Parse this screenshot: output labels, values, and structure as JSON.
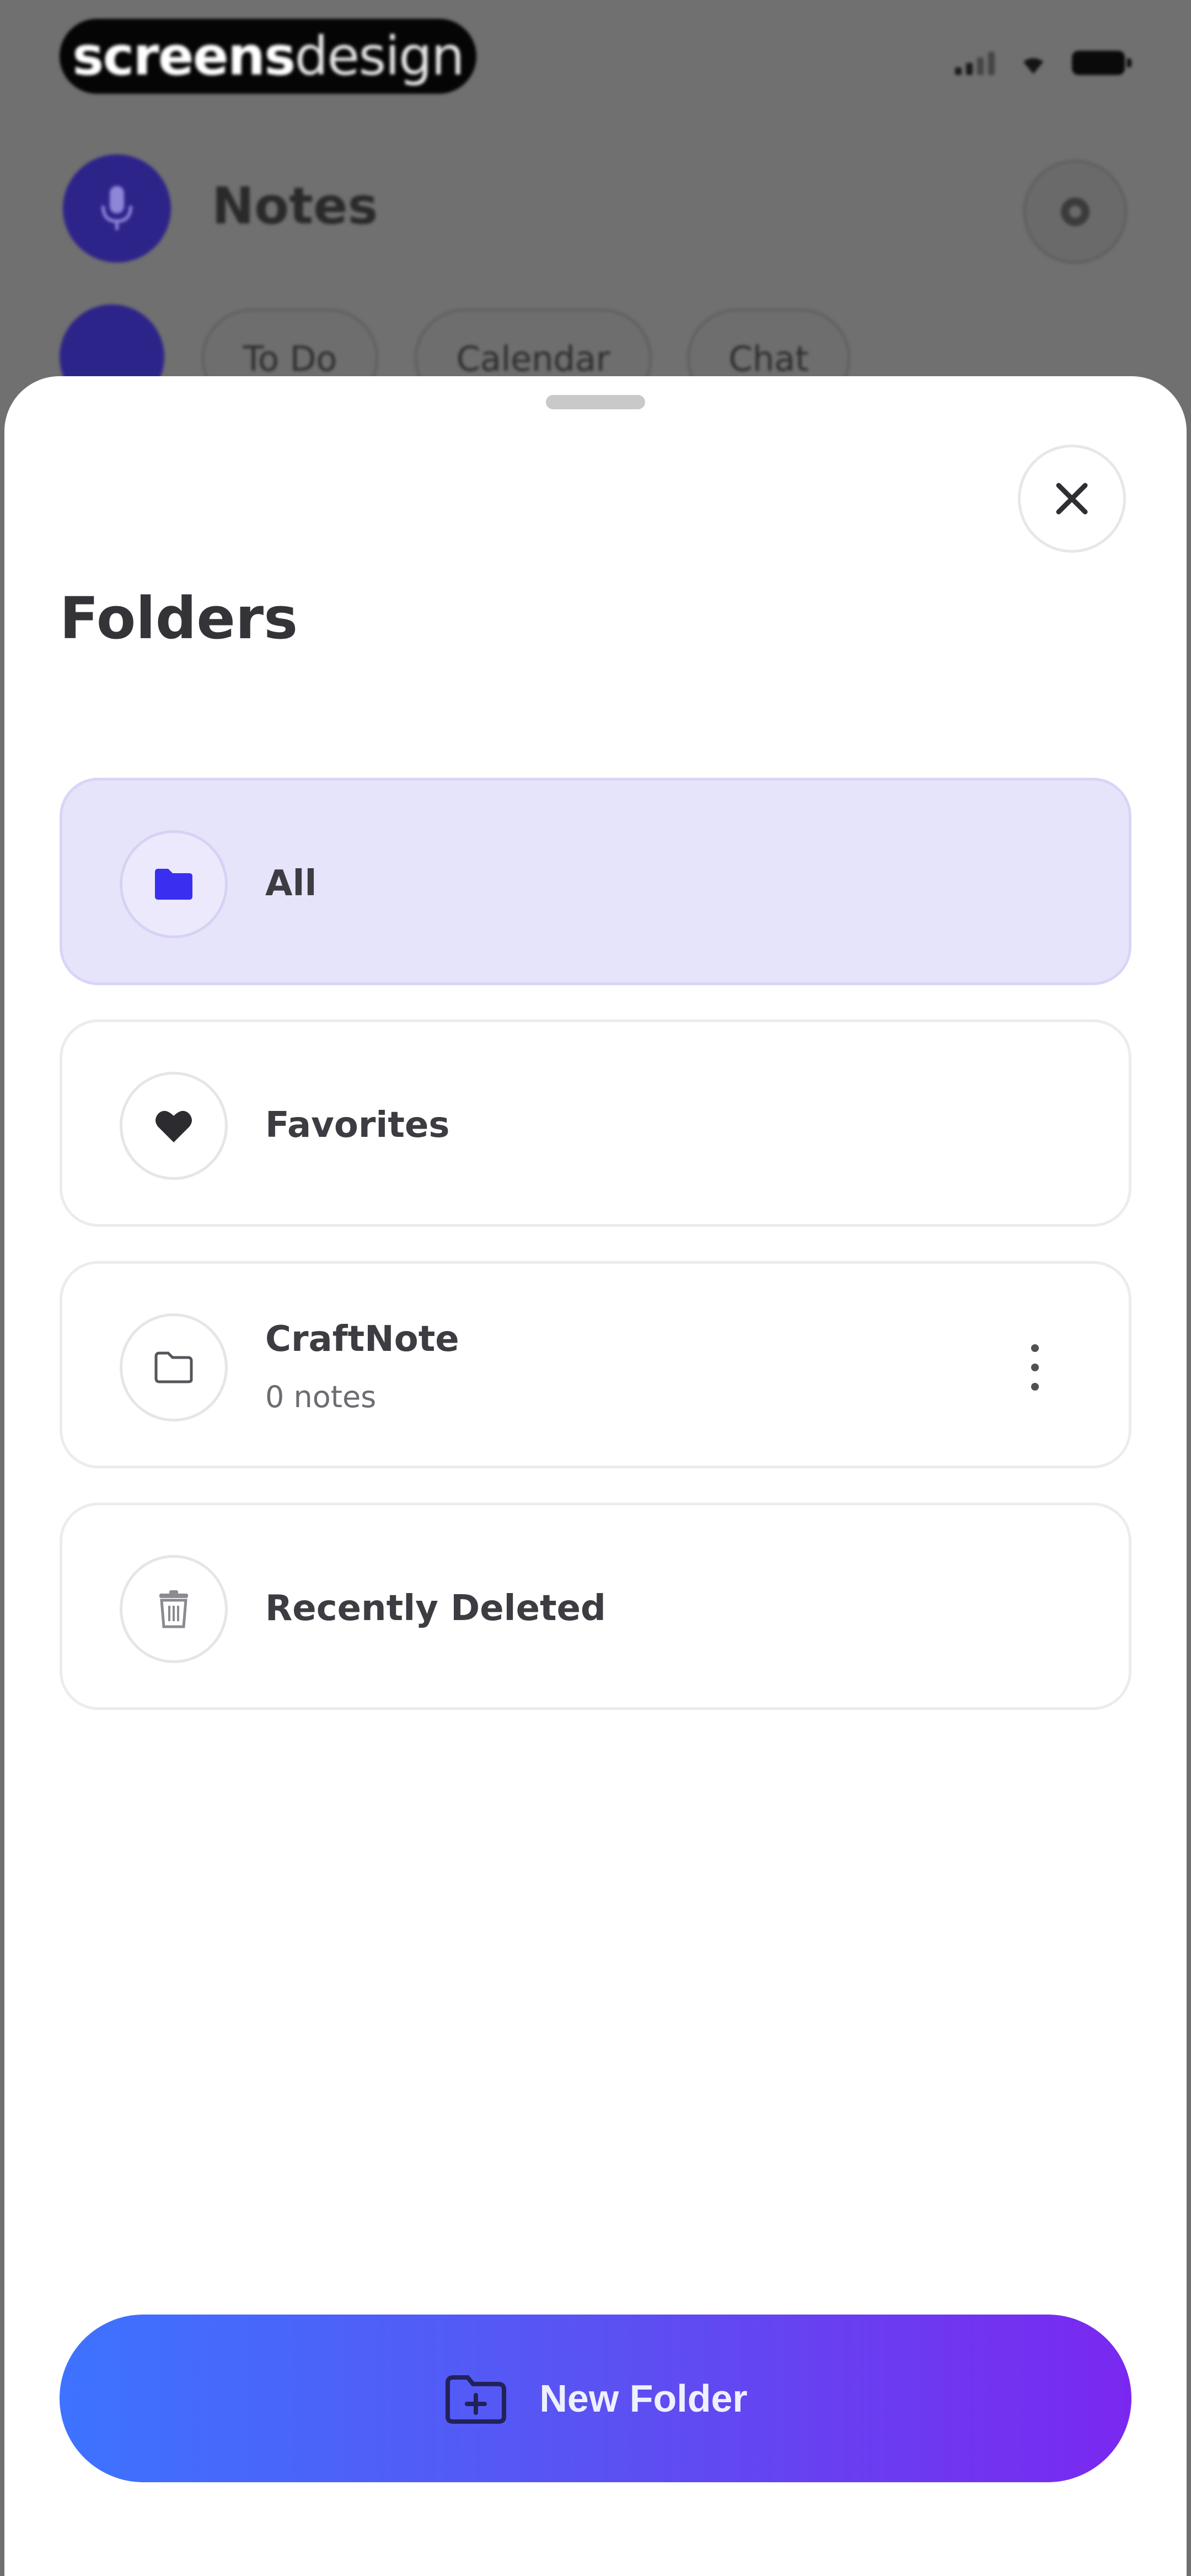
{
  "brand": {
    "part1": "screens",
    "part2": "design"
  },
  "header": {
    "title": "Notes"
  },
  "chips": [
    "To Do",
    "Calendar",
    "Chat"
  ],
  "sheet": {
    "title": "Folders",
    "folders": [
      {
        "label": "All",
        "icon": "folder-filled-icon",
        "active": true
      },
      {
        "label": "Favorites",
        "icon": "heart-icon",
        "active": false
      },
      {
        "label": "CraftNote",
        "subtitle": "0 notes",
        "icon": "folder-outline-icon",
        "active": false
      },
      {
        "label": "Recently Deleted",
        "icon": "trash-icon",
        "active": false
      }
    ],
    "new_folder_label": "New Folder"
  },
  "colors": {
    "accent": "#3a2ff0",
    "active_row": "#e6e4fb",
    "gradient_start": "#3d73ff",
    "gradient_end": "#7a28f0"
  }
}
